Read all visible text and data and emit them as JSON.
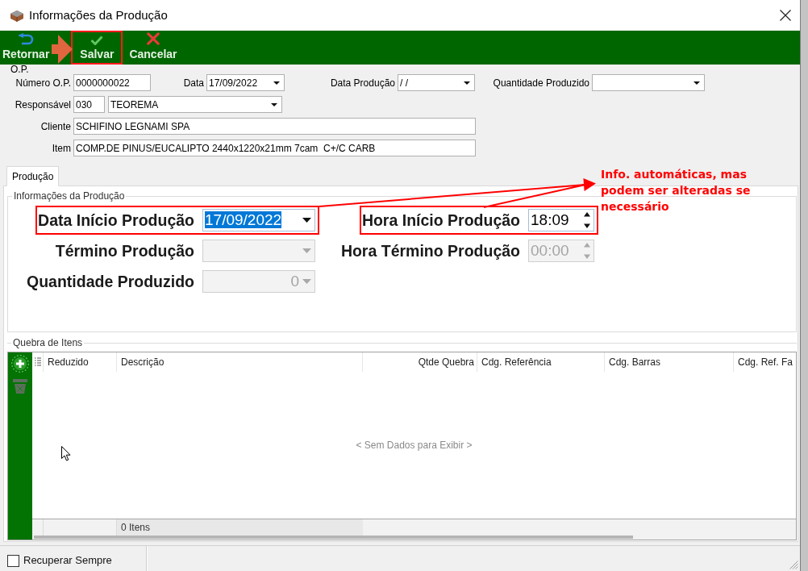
{
  "window": {
    "title": "Informações da Produção"
  },
  "toolbar": [
    {
      "label": "Retornar",
      "kind": "return",
      "highlighted": false
    },
    {
      "label": "Salvar",
      "kind": "save",
      "highlighted": true
    },
    {
      "label": "Cancelar",
      "kind": "cancel",
      "highlighted": false
    }
  ],
  "header": {
    "group_label": "O.P.",
    "rows": [
      [
        {
          "label": "Número O.P.",
          "value": "0000000022",
          "kind": "text"
        },
        {
          "label": "Data",
          "value": "17/09/2022",
          "kind": "combo"
        },
        {
          "label": "Data Produção",
          "value": "/ /",
          "kind": "combo"
        },
        {
          "label": "Quantidade Produzido",
          "kind": "combo"
        }
      ],
      [
        {
          "label": "Responsável",
          "code": "030",
          "value": "TEOREMA",
          "kind": "lookup"
        }
      ],
      [
        {
          "label": "Cliente",
          "value": "SCHIFINO LEGNAMI SPA",
          "kind": "text"
        }
      ],
      [
        {
          "label": "Item",
          "value": "COMP.DE PINUS/EUCALIPTO 2440x1220x21mm 7cam  C+/C CARB",
          "kind": "text"
        }
      ]
    ]
  },
  "tabs": [
    {
      "label": "Produção",
      "selected": true
    }
  ],
  "production": {
    "title": "Informações da Produção",
    "fields": [
      {
        "label": "Data Início Produção",
        "value": "17/09/2022",
        "kind": "date",
        "disabled": false,
        "text_selected": true,
        "highlighted": true
      },
      {
        "label": "Hora Início Produção",
        "value": "18:09",
        "kind": "time",
        "disabled": false,
        "text_selected": false,
        "highlighted": true
      },
      {
        "label": "Término Produção",
        "kind": "date",
        "disabled": true,
        "text_selected": false,
        "highlighted": false
      },
      {
        "label": "Hora Término Produção",
        "value": "00:00",
        "kind": "time",
        "disabled": true,
        "text_selected": false,
        "highlighted": false
      },
      {
        "label": "Quantidade Produzido",
        "value": "0",
        "kind": "number",
        "disabled": true,
        "text_selected": false,
        "highlighted": false
      }
    ]
  },
  "annotation": {
    "text": "Info. automáticas, mas podem ser alteradas se necessário"
  },
  "breakdown": {
    "title": "Quebra de Itens",
    "side_buttons": [
      {
        "kind": "add",
        "disabled": false
      },
      {
        "kind": "delete",
        "disabled": true
      }
    ],
    "columns": [
      {
        "label": "Reduzido",
        "kind": "text"
      },
      {
        "label": "Descrição",
        "kind": "text"
      },
      {
        "label": "Qtde Quebra",
        "kind": "number"
      },
      {
        "label": "Cdg. Referência",
        "kind": "text"
      },
      {
        "label": "Cdg. Barras",
        "kind": "text"
      },
      {
        "label": "Cdg. Ref. Fa",
        "kind": "text"
      }
    ],
    "empty_text": "< Sem Dados para Exibir >",
    "footer": "0 Itens"
  },
  "status_bar": {
    "checkbox": {
      "label": "Recuperar Sempre",
      "checked": false
    }
  }
}
